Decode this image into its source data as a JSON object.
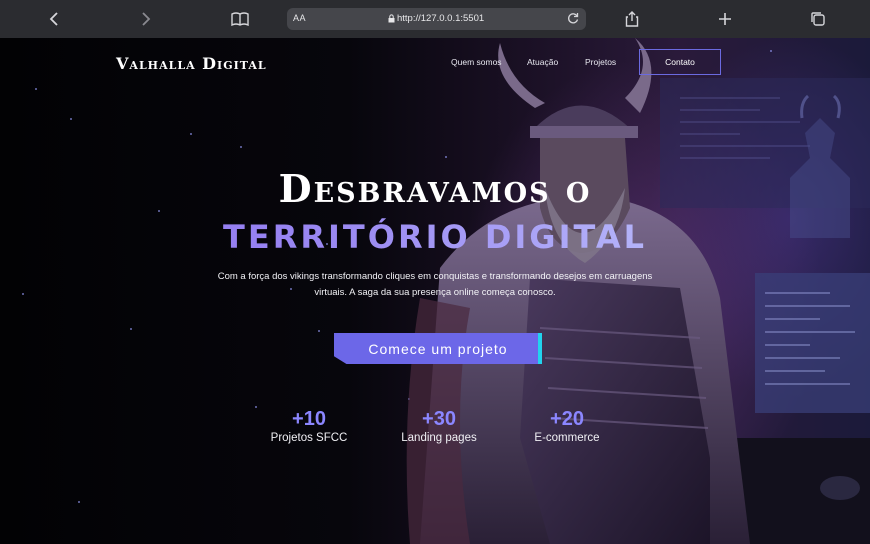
{
  "browser": {
    "text_size_label": "AA",
    "url": "http://127.0.0.1:5501"
  },
  "nav": {
    "logo": "Valhalla Digital",
    "items": [
      {
        "label": "Quem somos"
      },
      {
        "label": "Atuação"
      },
      {
        "label": "Projetos"
      }
    ],
    "contact": "Contato"
  },
  "hero": {
    "title_line1": "Desbravamos o",
    "title_line2": "TERRITÓRIO DIGITAL",
    "subtitle": "Com a força dos vikings transformando cliques em conquistas e transformando desejos em carruagens virtuais. A saga da sua presença online começa conosco.",
    "cta": "Comece um projeto"
  },
  "stats": [
    {
      "value": "+10",
      "label": "Projetos SFCC"
    },
    {
      "value": "+30",
      "label": "Landing pages"
    },
    {
      "value": "+20",
      "label": "E-commerce"
    }
  ],
  "colors": {
    "accent": "#6c67e8",
    "cta_edge": "#22d3ee",
    "stat_number": "#8b86ff"
  }
}
